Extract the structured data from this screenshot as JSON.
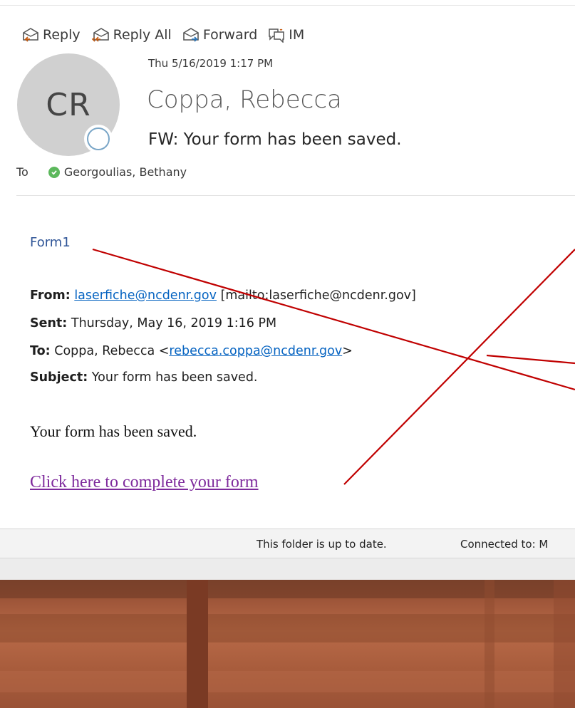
{
  "toolbar": {
    "reply_label": "Reply",
    "reply_all_label": "Reply All",
    "forward_label": "Forward",
    "im_label": "IM"
  },
  "message": {
    "avatar_initials": "CR",
    "date": "Thu 5/16/2019 1:17 PM",
    "sender": "Coppa, Rebecca",
    "subject": "FW: Your form has been saved.",
    "to_label": "To",
    "recipient": "Georgoulias, Bethany"
  },
  "body": {
    "form_title": "Form1",
    "from_label": "From:",
    "from_email": "laserfiche@ncdenr.gov",
    "from_mailto": "[mailto:laserfiche@ncdenr.gov]",
    "sent_label": "Sent:",
    "sent_value": "Thursday, May 16, 2019 1:16 PM",
    "to_label": "To:",
    "to_name": "Coppa, Rebecca <",
    "to_email": "rebecca.coppa@ncdenr.gov",
    "to_close": ">",
    "subject_label": "Subject:",
    "subject_value": "Your form has been saved.",
    "body_text": "Your form has been saved.",
    "complete_link": "Click here to complete your form"
  },
  "status_bar": {
    "folder_status": "This folder is up to date.",
    "connection": "Connected to: M"
  },
  "colors": {
    "link_blue": "#0563c1",
    "visited_purple": "#7e2a9c",
    "annotation_red": "#c00000",
    "presence_green": "#5cb85c"
  }
}
